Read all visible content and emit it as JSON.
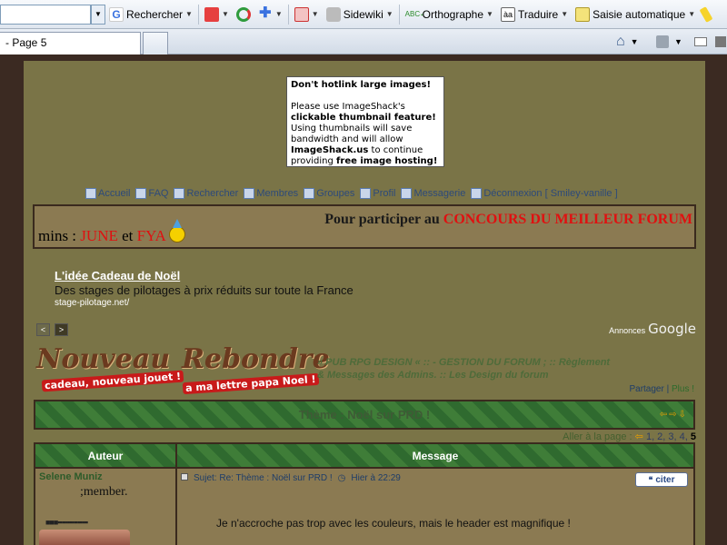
{
  "toolbar": {
    "search_label": "Rechercher",
    "sidewiki_label": "Sidewiki",
    "spell_label": "Orthographe",
    "translate_label": "Traduire",
    "autofill_label": "Saisie automatique"
  },
  "tab": {
    "title": "- Page 5"
  },
  "hotlink": {
    "heading": "Don't hotlink large images!",
    "line1": "Please use ImageShack's",
    "line2": "clickable thumbnail feature!",
    "line3": "Using thumbnails will save",
    "line4": "bandwidth and will allow",
    "line5_bold": "ImageShack.us",
    "line5_rest": " to continue",
    "line6": "providing ",
    "line6_bold": "free image hosting!"
  },
  "nav": {
    "items": [
      "Accueil",
      "FAQ",
      "Rechercher",
      "Membres",
      "Groupes",
      "Profil",
      "Messagerie",
      "Déconnexion [ Smiley-vanille ]"
    ]
  },
  "banner": {
    "left_pre": "mins : ",
    "left_red1": "JUNE",
    "left_mid": " et ",
    "left_red2": "FYA",
    "right_pre": "Pour participer au ",
    "right_red": "CONCOURS DU MEILLEUR FORUM"
  },
  "ad": {
    "title": "L'idée Cadeau de Noël",
    "desc": "Des stages de pilotages à prix réduits sur toute la France",
    "url": "stage-pilotage.net/",
    "prev": "<",
    "next": ">",
    "annonces": "Annonces",
    "google": "Google"
  },
  "buttons": {
    "new_label": "Nouveau",
    "new_sub": "cadeau, nouveau jouet !",
    "reply_label": "Rebondre",
    "reply_sub": "a ma lettre papa Noel !"
  },
  "breadcrumb": {
    "part1": "» PUB RPG DESIGN « :: - GESTION DU FORUM ; :: Règlement & Messages des Admins. :: Les Design du forum"
  },
  "share": {
    "partager": "Partager",
    "sep": " | ",
    "plus": "Plus !"
  },
  "topic": {
    "title": "Thème : Noël sur PRD !",
    "arrows": "⇦⇨⇩"
  },
  "pager": {
    "label": "Aller à la page : ",
    "pages": "1, 2, 3, 4, ",
    "current": "5"
  },
  "table": {
    "author_header": "Auteur",
    "message_header": "Message"
  },
  "post": {
    "author": "Selene Muniz",
    "rank": ";member.",
    "subject": "Sujet: Re: Thème : Noël sur PRD !",
    "date": "Hier à 22:29",
    "quote": "citer",
    "body": "Je n'accroche pas trop avec les couleurs, mais le header est magnifique !"
  }
}
